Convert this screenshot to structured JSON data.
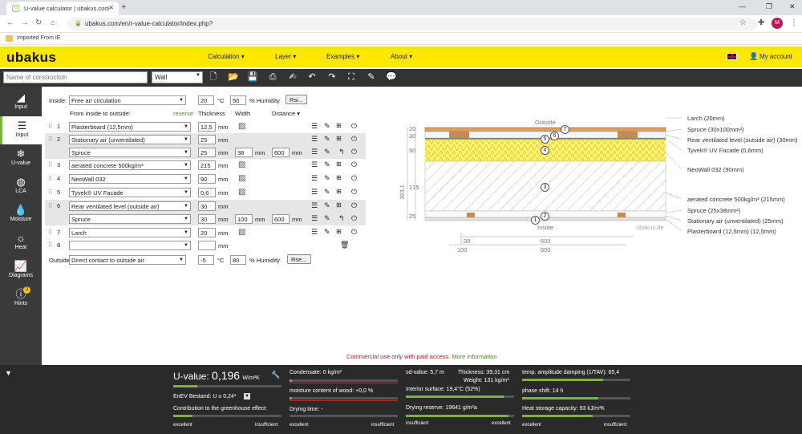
{
  "browser": {
    "tab_title": "U-value calculator | ubakus.com",
    "url": "ubakus.com/en/r-value-calculator/index.php?",
    "bookmark": "Imported From IE",
    "avatar": "M"
  },
  "header": {
    "logo": "ubakus",
    "menu": [
      "Calculation ▾",
      "Layer ▾",
      "Examples ▾",
      "About ▾"
    ],
    "account": "My account"
  },
  "toolbar": {
    "construction_placeholder": "Name of construction",
    "type": "Wall"
  },
  "sidebar": [
    {
      "label": "Input",
      "icon": "input-icon"
    },
    {
      "label": "Input",
      "icon": "layers-icon",
      "active": true
    },
    {
      "label": "U-value",
      "icon": "snowflake-icon"
    },
    {
      "label": "LCA",
      "icon": "globe-icon"
    },
    {
      "label": "Moisture",
      "icon": "drop-icon"
    },
    {
      "label": "Heat",
      "icon": "sun-icon"
    },
    {
      "label": "Diagrams",
      "icon": "chart-icon"
    },
    {
      "label": "Hints",
      "icon": "hint-icon",
      "badge": "3"
    }
  ],
  "form": {
    "inside_label": "Inside:",
    "inside_value": "Free air circulation",
    "inside_temp": "20",
    "temp_unit": "°C",
    "inside_hum": "50",
    "hum_unit": "% Humidity",
    "inside_btn": "Rsi...",
    "col_from": "From inside to outside:",
    "reverse": "reverse",
    "col_thick": "Thickness",
    "col_width": "Width",
    "col_dist": "Distance ▾",
    "rows": [
      {
        "n": "1",
        "mat": "Plasterboard (12,5mm)",
        "thick": "12,5",
        "unit": "mm",
        "bg": false
      },
      {
        "n": "2",
        "mat": "Stationary air (unventilated)",
        "thick": "25",
        "unit": "mm",
        "bg": true
      },
      {
        "n": "",
        "mat": "Spruce",
        "thick": "25",
        "unit": "mm",
        "width": "38",
        "wunit": "mm",
        "dist": "600",
        "dunit": "mm",
        "bg": true,
        "sub": true
      },
      {
        "n": "3",
        "mat": "aerated concrete 500kg/m³",
        "thick": "215",
        "unit": "mm",
        "bg": false
      },
      {
        "n": "4",
        "mat": "NeoWall 032",
        "thick": "90",
        "unit": "mm",
        "bg": false
      },
      {
        "n": "5",
        "mat": "Tyvek® UV Facade",
        "thick": "0,6",
        "unit": "mm",
        "bg": false
      },
      {
        "n": "6",
        "mat": "Rear ventilated level (outside air)",
        "thick": "30",
        "unit": "mm",
        "bg": true
      },
      {
        "n": "",
        "mat": "Spruce",
        "thick": "30",
        "unit": "mm",
        "width": "100",
        "wunit": "mm",
        "dist": "600",
        "dunit": "mm",
        "bg": true,
        "sub": true
      },
      {
        "n": "7",
        "mat": "Larch",
        "thick": "20",
        "unit": "mm",
        "bg": false
      },
      {
        "n": "8",
        "mat": "",
        "thick": "",
        "unit": "mm",
        "bg": false,
        "empty": true
      }
    ],
    "outside_label": "Outside",
    "outside_value": "Direct contact to outside air",
    "outside_temp": "-5",
    "outside_hum": "80",
    "outside_btn": "Rse..."
  },
  "diagram": {
    "outside": "Outside",
    "inside": "Inside",
    "watermark": "ubakus.de",
    "left_dims": [
      "20",
      "30",
      "90",
      "215",
      "25"
    ],
    "total": "393,1",
    "bottom_dims": [
      "38",
      "600",
      "100",
      "600"
    ],
    "labels": [
      "Larch (20mm)",
      "Spruce (30x100mm²)",
      "Rear ventilated level (outside air) (30mm)",
      "Tyvek® UV Facade (0,6mm)",
      "NeoWall 032 (90mm)",
      "aerated concrete 500kg/m³ (215mm)",
      "Spruce (25x38mm²)",
      "Stationary air (unventilated) (25mm)",
      "Plasterboard (12,5mm) (12,5mm)"
    ],
    "markers": [
      "7",
      "6",
      "5",
      "4",
      "3",
      "2",
      "1"
    ]
  },
  "notice": {
    "text": "Commercial use only with paid access.",
    "link": "More information"
  },
  "results": {
    "uvalue_label": "U-value:",
    "uvalue": "0,196",
    "uvalue_unit": "W/m²K",
    "enev": "EnEV Bestand: U ≤ 0,24*",
    "greenhouse": "Contribution to the greenhouse effect:",
    "condensate": "Condensate: 0 kg/m²",
    "moisture_wood": "moisture content of wood: +0,0 %",
    "drying_time": "Drying time: -",
    "sd": "sd-value: 5,7 m",
    "thickness": "Thickness: 39,31 cm",
    "weight": "Weight: 131 kg/m²",
    "interior": "Interior surface: 19,4°C (52%)",
    "drying_reserve": "Drying reserve: 19641 g/m²a",
    "temp_amp": "temp. amplitude damping (1/TAV): 65,4",
    "phase": "phase shift: 14 h",
    "heat_cap": "Heat storage capacity: 93 kJ/m²K",
    "excellent": "excellent",
    "insufficient": "insufficient",
    "bars": {
      "uvalue": 0.22,
      "greenhouse": 0.18,
      "condensate": 0.02,
      "moisture": 0.02,
      "interior": 0.9,
      "drying": 0.95,
      "tempamp": 0.75,
      "phase": 0.7,
      "heatcap": 0.65
    }
  }
}
